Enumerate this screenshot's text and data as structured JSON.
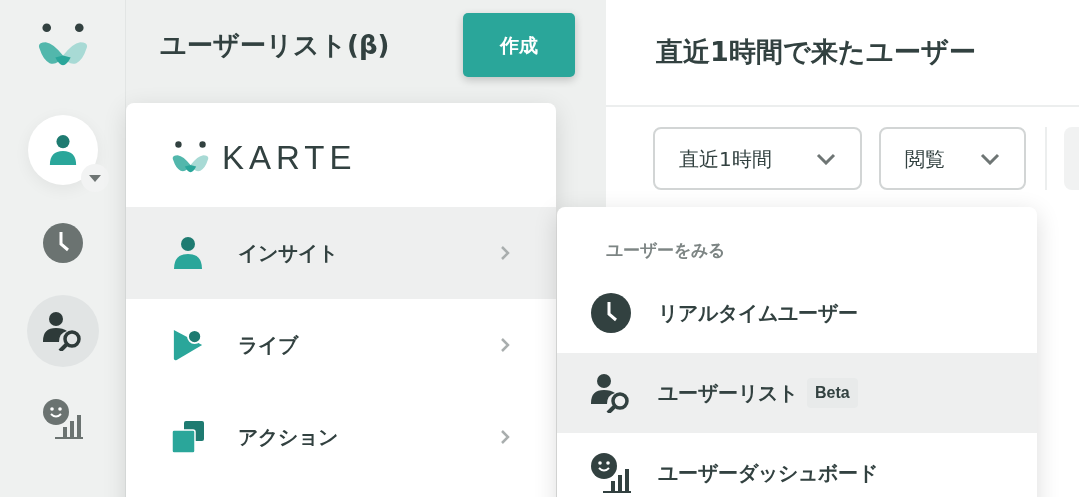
{
  "rail": {
    "items": [
      {
        "kind": "clock",
        "selected": false
      },
      {
        "kind": "user-search",
        "selected": true
      },
      {
        "kind": "smile-chart",
        "selected": false
      }
    ]
  },
  "list_header": {
    "title": "ユーザーリスト(β)",
    "create_button": "作成"
  },
  "main": {
    "title": "直近1時間で来たユーザー",
    "filters": [
      {
        "value": "直近1時間"
      },
      {
        "value": "閲覧"
      }
    ]
  },
  "menu": {
    "logo": "KARTE",
    "items": [
      {
        "kind": "person",
        "label": "インサイト",
        "selected": true
      },
      {
        "kind": "live",
        "label": "ライブ",
        "selected": false
      },
      {
        "kind": "action",
        "label": "アクション",
        "selected": false
      }
    ]
  },
  "submenu": {
    "heading": "ユーザーをみる",
    "items": [
      {
        "kind": "clock",
        "label": "リアルタイムユーザー",
        "selected": false
      },
      {
        "kind": "user-search",
        "label": "ユーザーリスト",
        "badge": "Beta",
        "selected": true
      },
      {
        "kind": "smile-chart",
        "label": "ユーザーダッシュボード",
        "selected": false
      }
    ]
  }
}
